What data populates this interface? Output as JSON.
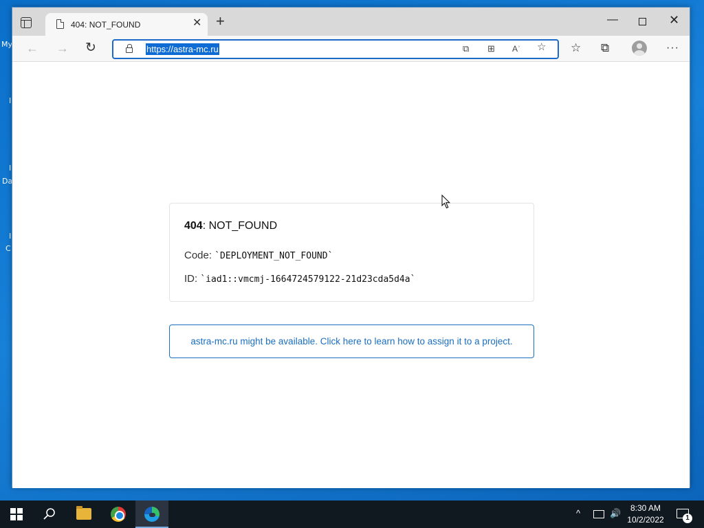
{
  "desktop": {
    "fragments": [
      "My",
      "I",
      "I",
      "Da",
      "I",
      "C"
    ]
  },
  "browser": {
    "tab": {
      "title": "404: NOT_FOUND",
      "close_glyph": "✕"
    },
    "new_tab_glyph": "+",
    "window_controls": {
      "minimize": "—",
      "close": "✕"
    },
    "toolbar": {
      "back_glyph": "←",
      "forward_glyph": "→",
      "refresh_glyph": "↻",
      "url": "https://astra-mc.ru",
      "address_icons": [
        "⧉",
        "⊞",
        "Aʾ",
        "☆"
      ],
      "favorites_glyph": "☆",
      "collections_glyph": "⧉",
      "more_glyph": "···"
    }
  },
  "page": {
    "error_code": "404",
    "error_separator": ": ",
    "error_name": "NOT_FOUND",
    "code_label": "Code: ",
    "code_value": "`DEPLOYMENT_NOT_FOUND`",
    "id_label": "ID: ",
    "id_value": "`iad1::vmcmj-1664724579122-21d23cda5d4a`",
    "info_link": "astra-mc.ru might be available. Click here to learn how to assign it to a project."
  },
  "taskbar": {
    "tray_up_glyph": "^",
    "volume_glyph": "🔊",
    "lang": "",
    "time": "8:30 AM",
    "date": "10/2/2022",
    "notification_count": "1"
  },
  "colors": {
    "accent": "#1a6fc0",
    "address_border": "#1b6ac9",
    "desktop": "#0a6fc9",
    "taskbar": "#101820"
  }
}
